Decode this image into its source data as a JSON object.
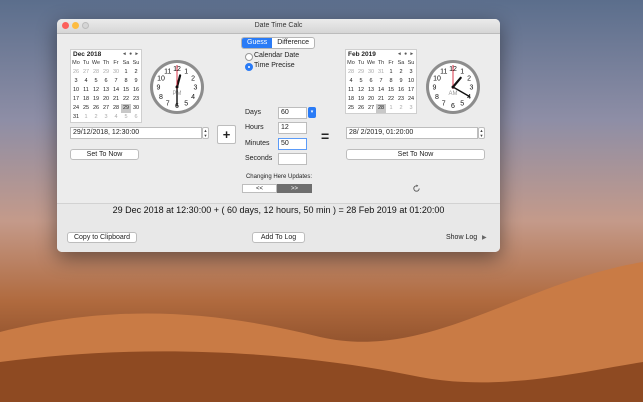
{
  "window": {
    "title": "Date Time Calc"
  },
  "tabs": [
    {
      "label": "Guess"
    },
    {
      "label": "Difference"
    }
  ],
  "mode": {
    "calendar_date": "Calendar Date",
    "time_precise": "Time Precise",
    "selected": "time_precise"
  },
  "left_calendar": {
    "month_label": "Dec 2018",
    "weekdays": [
      "Mo",
      "Tu",
      "We",
      "Th",
      "Fr",
      "Sa",
      "Su"
    ],
    "days": [
      "26",
      "27",
      "28",
      "29",
      "30",
      "1",
      "2",
      "3",
      "4",
      "5",
      "6",
      "7",
      "8",
      "9",
      "10",
      "11",
      "12",
      "13",
      "14",
      "15",
      "16",
      "17",
      "18",
      "19",
      "20",
      "21",
      "22",
      "23",
      "24",
      "25",
      "26",
      "27",
      "28",
      "29",
      "30",
      "31",
      "1",
      "2",
      "3",
      "4",
      "5",
      "6"
    ],
    "selected_index": 33,
    "other_month_indices": [
      0,
      1,
      2,
      3,
      4,
      36,
      37,
      38,
      39,
      40,
      41
    ]
  },
  "right_calendar": {
    "month_label": "Feb 2019",
    "weekdays": [
      "Mo",
      "Tu",
      "We",
      "Th",
      "Fr",
      "Sa",
      "Su"
    ],
    "days": [
      "28",
      "29",
      "30",
      "31",
      "1",
      "2",
      "3",
      "4",
      "5",
      "6",
      "7",
      "8",
      "9",
      "10",
      "11",
      "12",
      "13",
      "14",
      "15",
      "16",
      "17",
      "18",
      "19",
      "20",
      "21",
      "22",
      "23",
      "24",
      "25",
      "26",
      "27",
      "28",
      "1",
      "2",
      "3"
    ],
    "selected_index": 31,
    "other_month_indices": [
      0,
      1,
      2,
      3,
      32,
      33,
      34
    ]
  },
  "left_clock": {
    "hour": 12,
    "minute": 30,
    "ampm": "PM"
  },
  "right_clock": {
    "hour": 1,
    "minute": 20,
    "ampm": "AM"
  },
  "left_datetime": "29/12/2018, 12:30:00",
  "right_datetime": "28/  2/2019, 01:20:00",
  "set_to_now_label": "Set To Now",
  "plus_label": "+",
  "equals_label": "=",
  "inputs": {
    "days_label": "Days",
    "days_value": "60",
    "hours_label": "Hours",
    "hours_value": "12",
    "minutes_label": "Minutes",
    "minutes_value": "50",
    "seconds_label": "Seconds",
    "seconds_value": ""
  },
  "changing_label": "Changing Here Updates:",
  "arrow_left": "<<",
  "arrow_right": ">>",
  "result": "29 Dec 2018 at 12:30:00 + ( 60 days, 12 hours, 50 min ) = 28 Feb 2019 at 01:20:00",
  "footer": {
    "copy": "Copy to Clipboard",
    "add_log": "Add To Log",
    "show_log": "Show Log"
  },
  "colors": {
    "accent": "#2a7bf6",
    "close": "#fc605b",
    "minimize": "#fdbc40"
  }
}
